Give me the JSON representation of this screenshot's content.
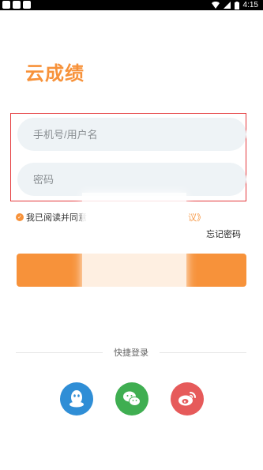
{
  "status_bar": {
    "time": "4:15"
  },
  "brand": {
    "title": "云成绩"
  },
  "login": {
    "username_placeholder": "手机号/用户名",
    "password_placeholder": "密码",
    "agree_text": "我已阅读并同意",
    "agree_link": "议》",
    "forgot_label": "忘记密码",
    "button_label": ""
  },
  "quick_login": {
    "divider_label": "快捷登录",
    "providers": [
      "qq-icon",
      "wechat-icon",
      "weibo-icon"
    ]
  },
  "colors": {
    "accent": "#f7923a",
    "qq": "#2f8ed6",
    "wechat": "#3fae51",
    "weibo": "#e65a5a",
    "highlight_border": "#e4393c"
  }
}
